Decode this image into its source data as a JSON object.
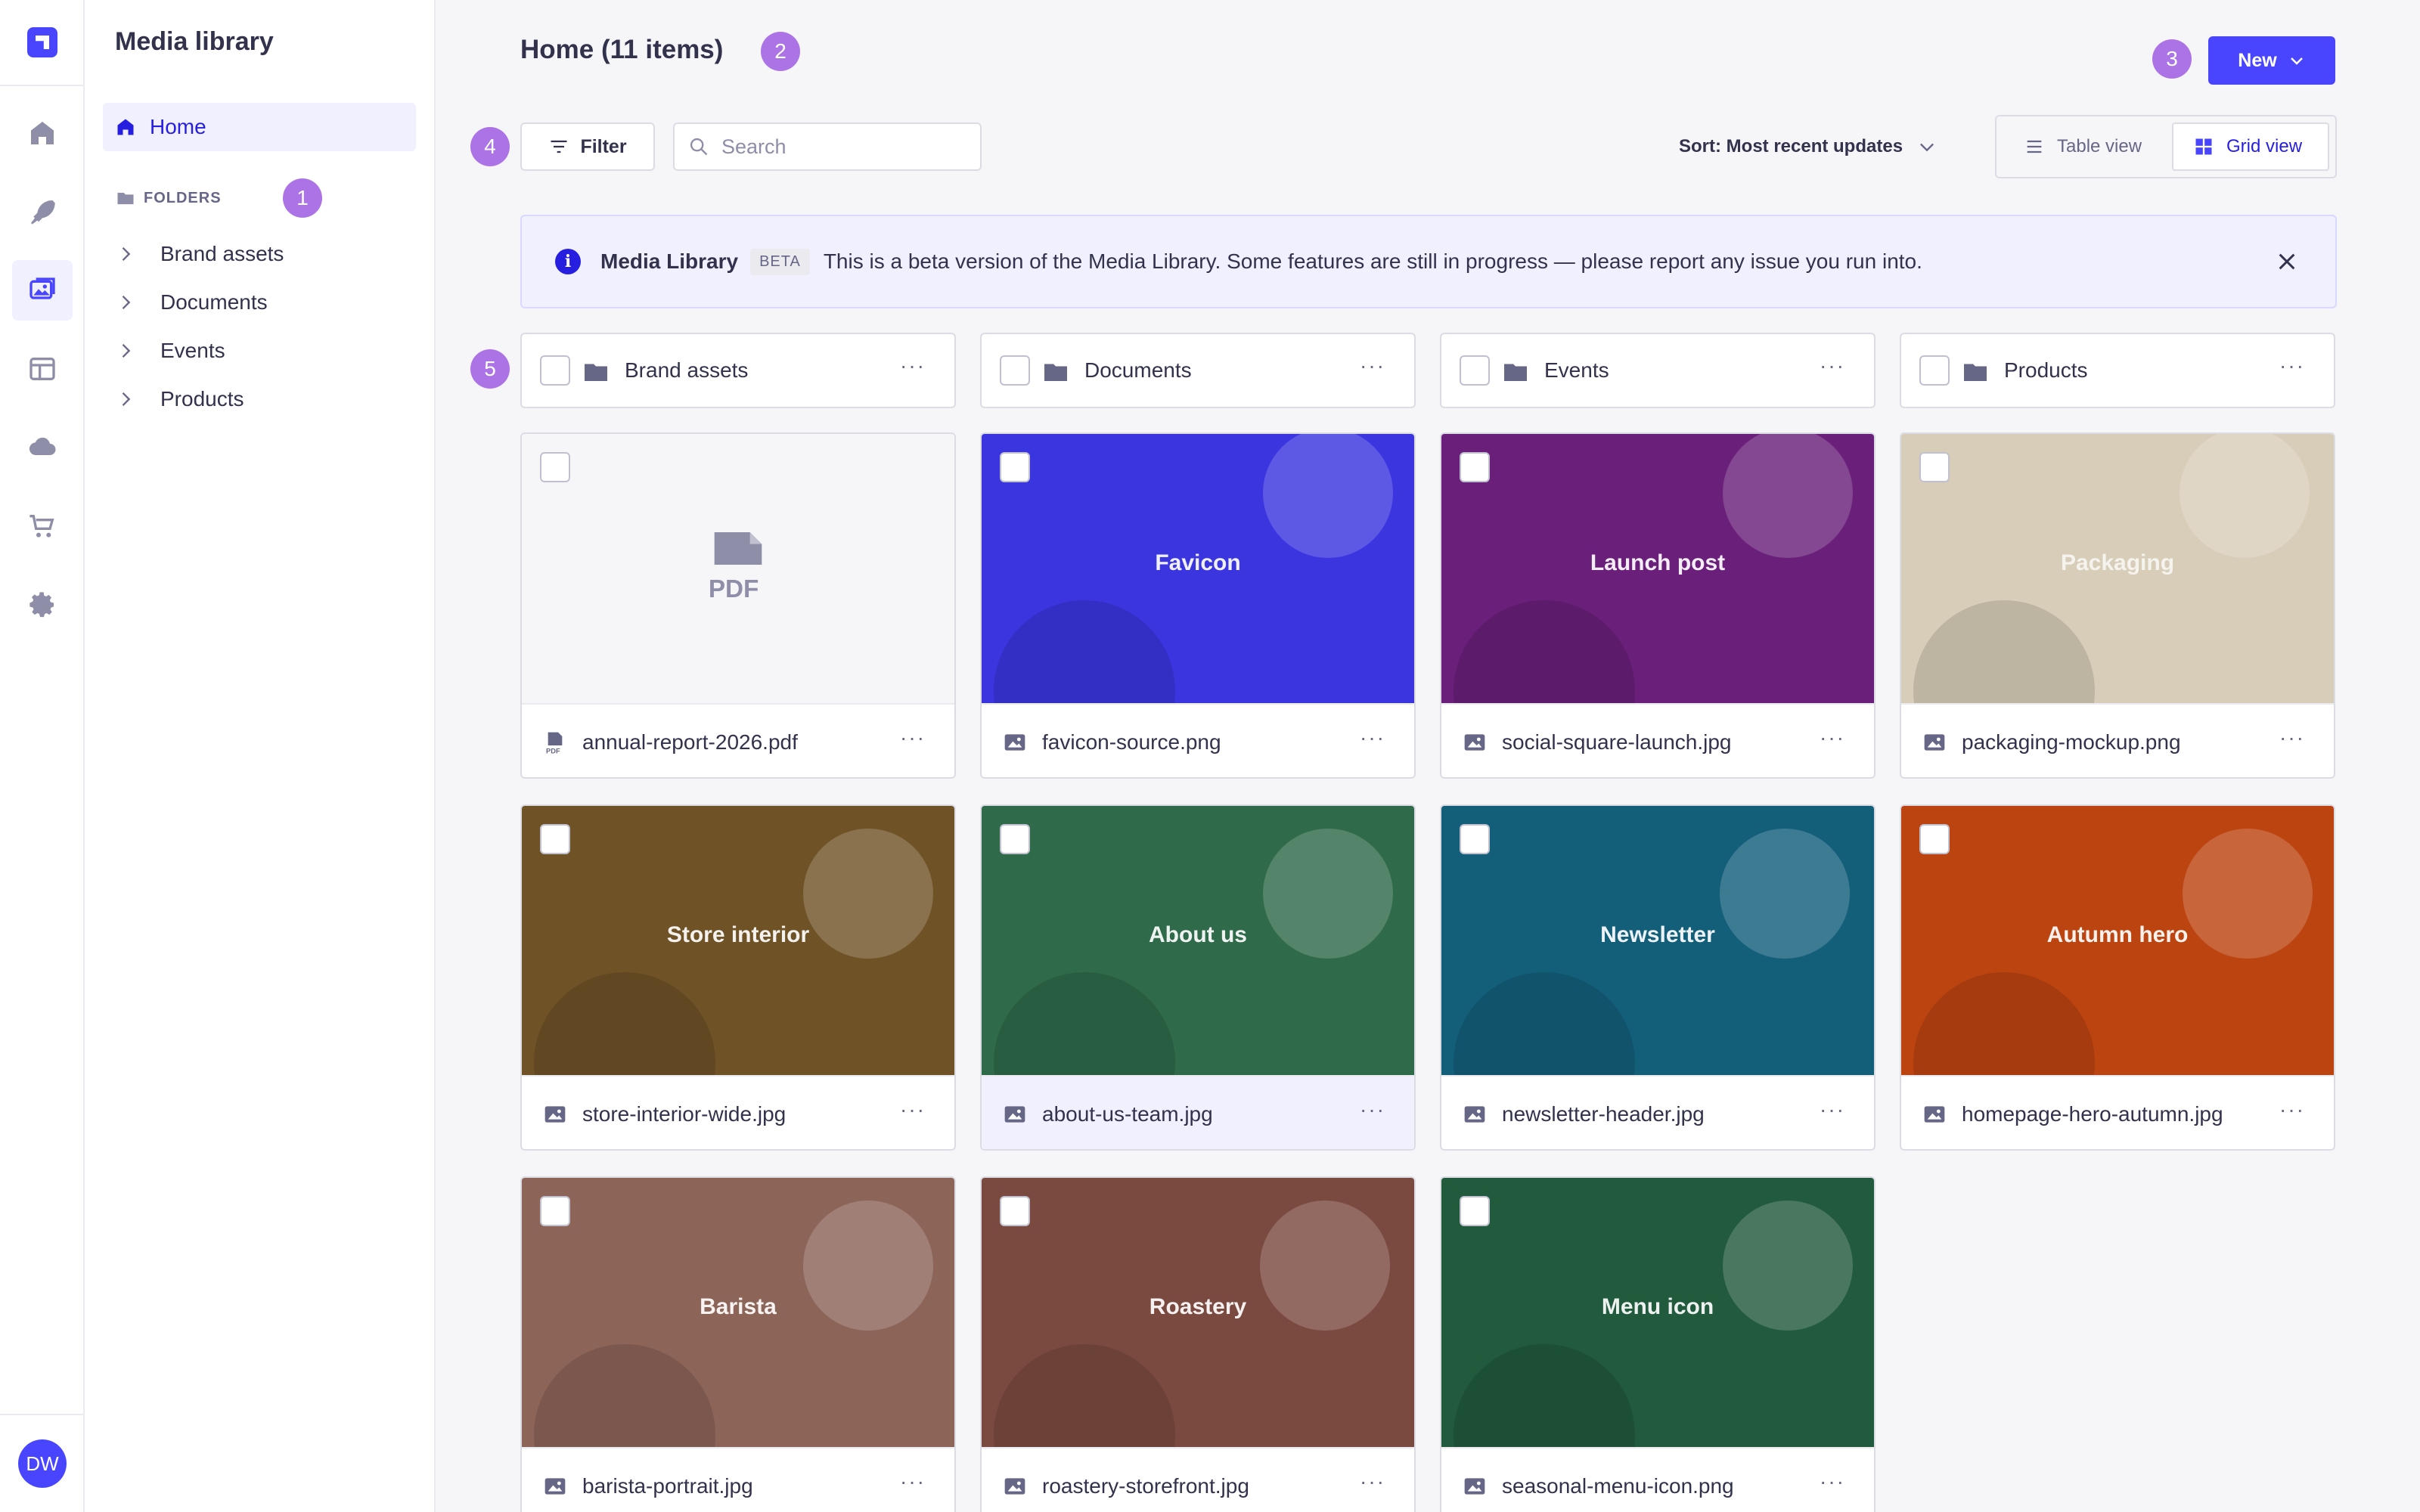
{
  "sidebar": {
    "title": "Media library",
    "home_label": "Home",
    "folders_label": "FOLDERS",
    "folders": [
      {
        "label": "Brand assets"
      },
      {
        "label": "Documents"
      },
      {
        "label": "Events"
      },
      {
        "label": "Products"
      }
    ],
    "avatar_initials": "DW"
  },
  "badges": [
    "1",
    "2",
    "3",
    "4",
    "5"
  ],
  "header": {
    "title": "Home (11 items)",
    "new_label": "New"
  },
  "toolbar": {
    "filter_label": "Filter",
    "search_placeholder": "Search",
    "sort_label": "Sort: Most recent updates",
    "table_view_label": "Table view",
    "grid_view_label": "Grid view"
  },
  "banner": {
    "title": "Media Library",
    "tag": "BETA",
    "text": "This is a beta version of the Media Library. Some features are still in progress — please report any issue you run into."
  },
  "folders": [
    {
      "name": "Brand assets"
    },
    {
      "name": "Documents"
    },
    {
      "name": "Events"
    },
    {
      "name": "Products"
    }
  ],
  "assets": [
    {
      "name": "annual-report-2026.pdf",
      "thumb_label": "",
      "color": "#f6f6f9",
      "type": "pdf"
    },
    {
      "name": "favicon-source.png",
      "thumb_label": "Favicon",
      "color": "#3b35e0",
      "type": "image"
    },
    {
      "name": "social-square-launch.jpg",
      "thumb_label": "Launch post",
      "color": "#6a1f7a",
      "type": "image"
    },
    {
      "name": "packaging-mockup.png",
      "thumb_label": "Packaging",
      "color": "#d8cdb9",
      "type": "image"
    },
    {
      "name": "store-interior-wide.jpg",
      "thumb_label": "Store interior",
      "color": "#6f5327",
      "type": "image"
    },
    {
      "name": "about-us-team.jpg",
      "thumb_label": "About us",
      "color": "#2f6a4a",
      "type": "image"
    },
    {
      "name": "newsletter-header.jpg",
      "thumb_label": "Newsletter",
      "color": "#135f7a",
      "type": "image"
    },
    {
      "name": "homepage-hero-autumn.jpg",
      "thumb_label": "Autumn hero",
      "color": "#bc4410",
      "type": "image"
    },
    {
      "name": "barista-portrait.jpg",
      "thumb_label": "Barista",
      "color": "#8c6458",
      "type": "image"
    },
    {
      "name": "roastery-storefront.jpg",
      "thumb_label": "Roastery",
      "color": "#7a4a40",
      "type": "image"
    },
    {
      "name": "seasonal-menu-icon.png",
      "thumb_label": "Menu icon",
      "color": "#225a3e",
      "type": "image"
    }
  ],
  "colors": {
    "primary": "#4945ff",
    "badge": "#ac73e6",
    "banner_bg": "#f0f0ff"
  }
}
